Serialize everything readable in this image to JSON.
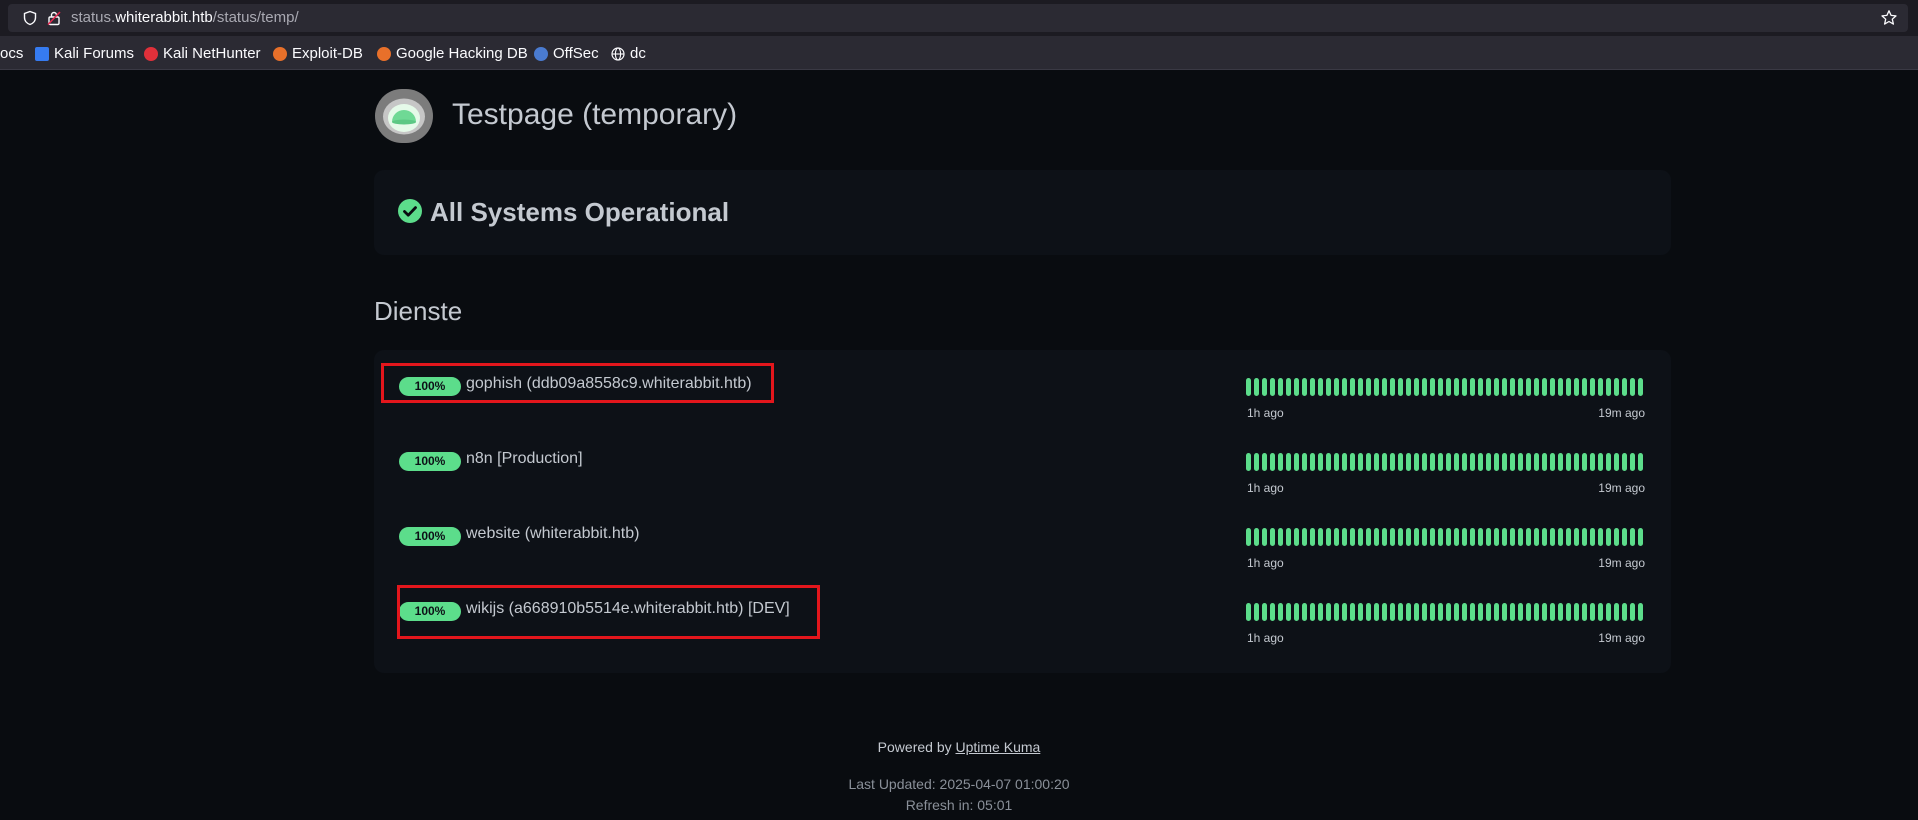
{
  "browser": {
    "url_prefix": "status.",
    "url_host": "whiterabbit.htb",
    "url_path": "/status/temp/",
    "bookmarks": [
      {
        "label": "ocs",
        "icon": "none",
        "color": ""
      },
      {
        "label": "Kali Forums",
        "icon": "kali-forums-icon",
        "color": "#367bf0"
      },
      {
        "label": "Kali NetHunter",
        "icon": "nethunter-icon",
        "color": "#e0303a"
      },
      {
        "label": "Exploit-DB",
        "icon": "exploit-db-icon",
        "color": "#e8702a"
      },
      {
        "label": "Google Hacking DB",
        "icon": "ghdb-icon",
        "color": "#e8702a"
      },
      {
        "label": "OffSec",
        "icon": "offsec-icon",
        "color": "#4a7bd0"
      },
      {
        "label": "dc",
        "icon": "globe-icon",
        "color": "#fbfbfe"
      }
    ]
  },
  "page": {
    "title": "Testpage (temporary)",
    "overall_status": "All Systems Operational",
    "group_title": "Dienste",
    "monitors": [
      {
        "uptime": "100%",
        "name": "gophish (ddb09a8558c9.whiterabbit.htb)",
        "from": "1h ago",
        "to": "19m ago"
      },
      {
        "uptime": "100%",
        "name": "n8n [Production]",
        "from": "1h ago",
        "to": "19m ago"
      },
      {
        "uptime": "100%",
        "name": "website (whiterabbit.htb)",
        "from": "1h ago",
        "to": "19m ago"
      },
      {
        "uptime": "100%",
        "name": "wikijs (a668910b5514e.whiterabbit.htb) [DEV]",
        "from": "1h ago",
        "to": "19m ago"
      }
    ],
    "heartbeat_count": 50,
    "heartbeat_status": "up"
  },
  "footer": {
    "powered_by": "Powered by",
    "powered_link": "Uptime Kuma",
    "last_updated": "Last Updated: 2025-04-07 01:00:20",
    "refresh": "Refresh in: 05:01"
  },
  "colors": {
    "up": "#5cdd8b",
    "highlight": "#e3161c",
    "background": "#090c10",
    "card": "#0d1117"
  }
}
